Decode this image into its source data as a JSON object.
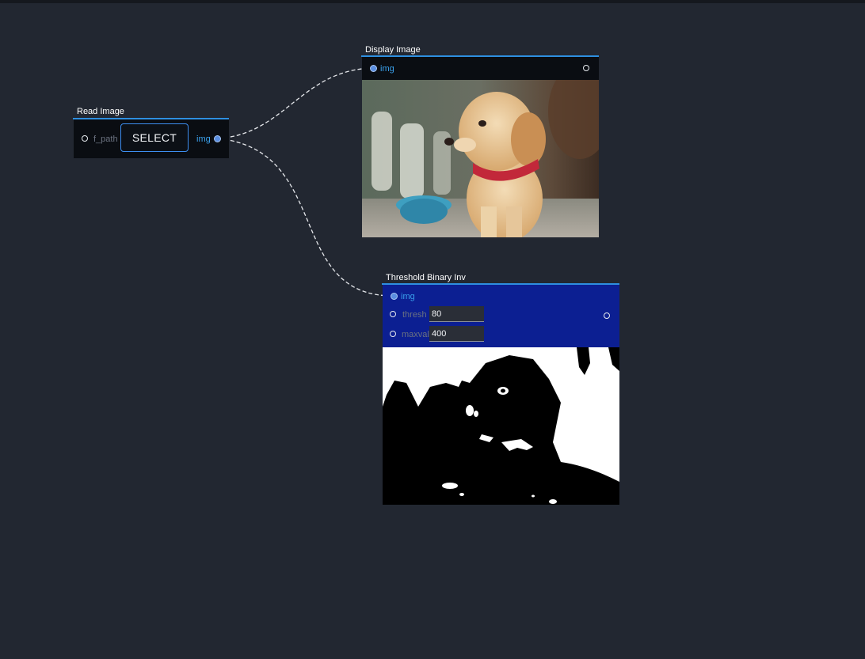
{
  "nodes": {
    "read_image": {
      "title": "Read Image",
      "input_label": "f_path",
      "button_label": "SELECT",
      "output_label": "img"
    },
    "display_image": {
      "title": "Display Image",
      "input_label": "img"
    },
    "threshold": {
      "title": "Threshold Binary Inv",
      "input_label": "img",
      "thresh_label": "thresh",
      "thresh_value": "80",
      "maxval_label": "maxval",
      "maxval_value": "400"
    }
  },
  "colors": {
    "canvas": "#222731",
    "accent": "#2e8fe0",
    "threshold_body": "#0c1f92"
  }
}
